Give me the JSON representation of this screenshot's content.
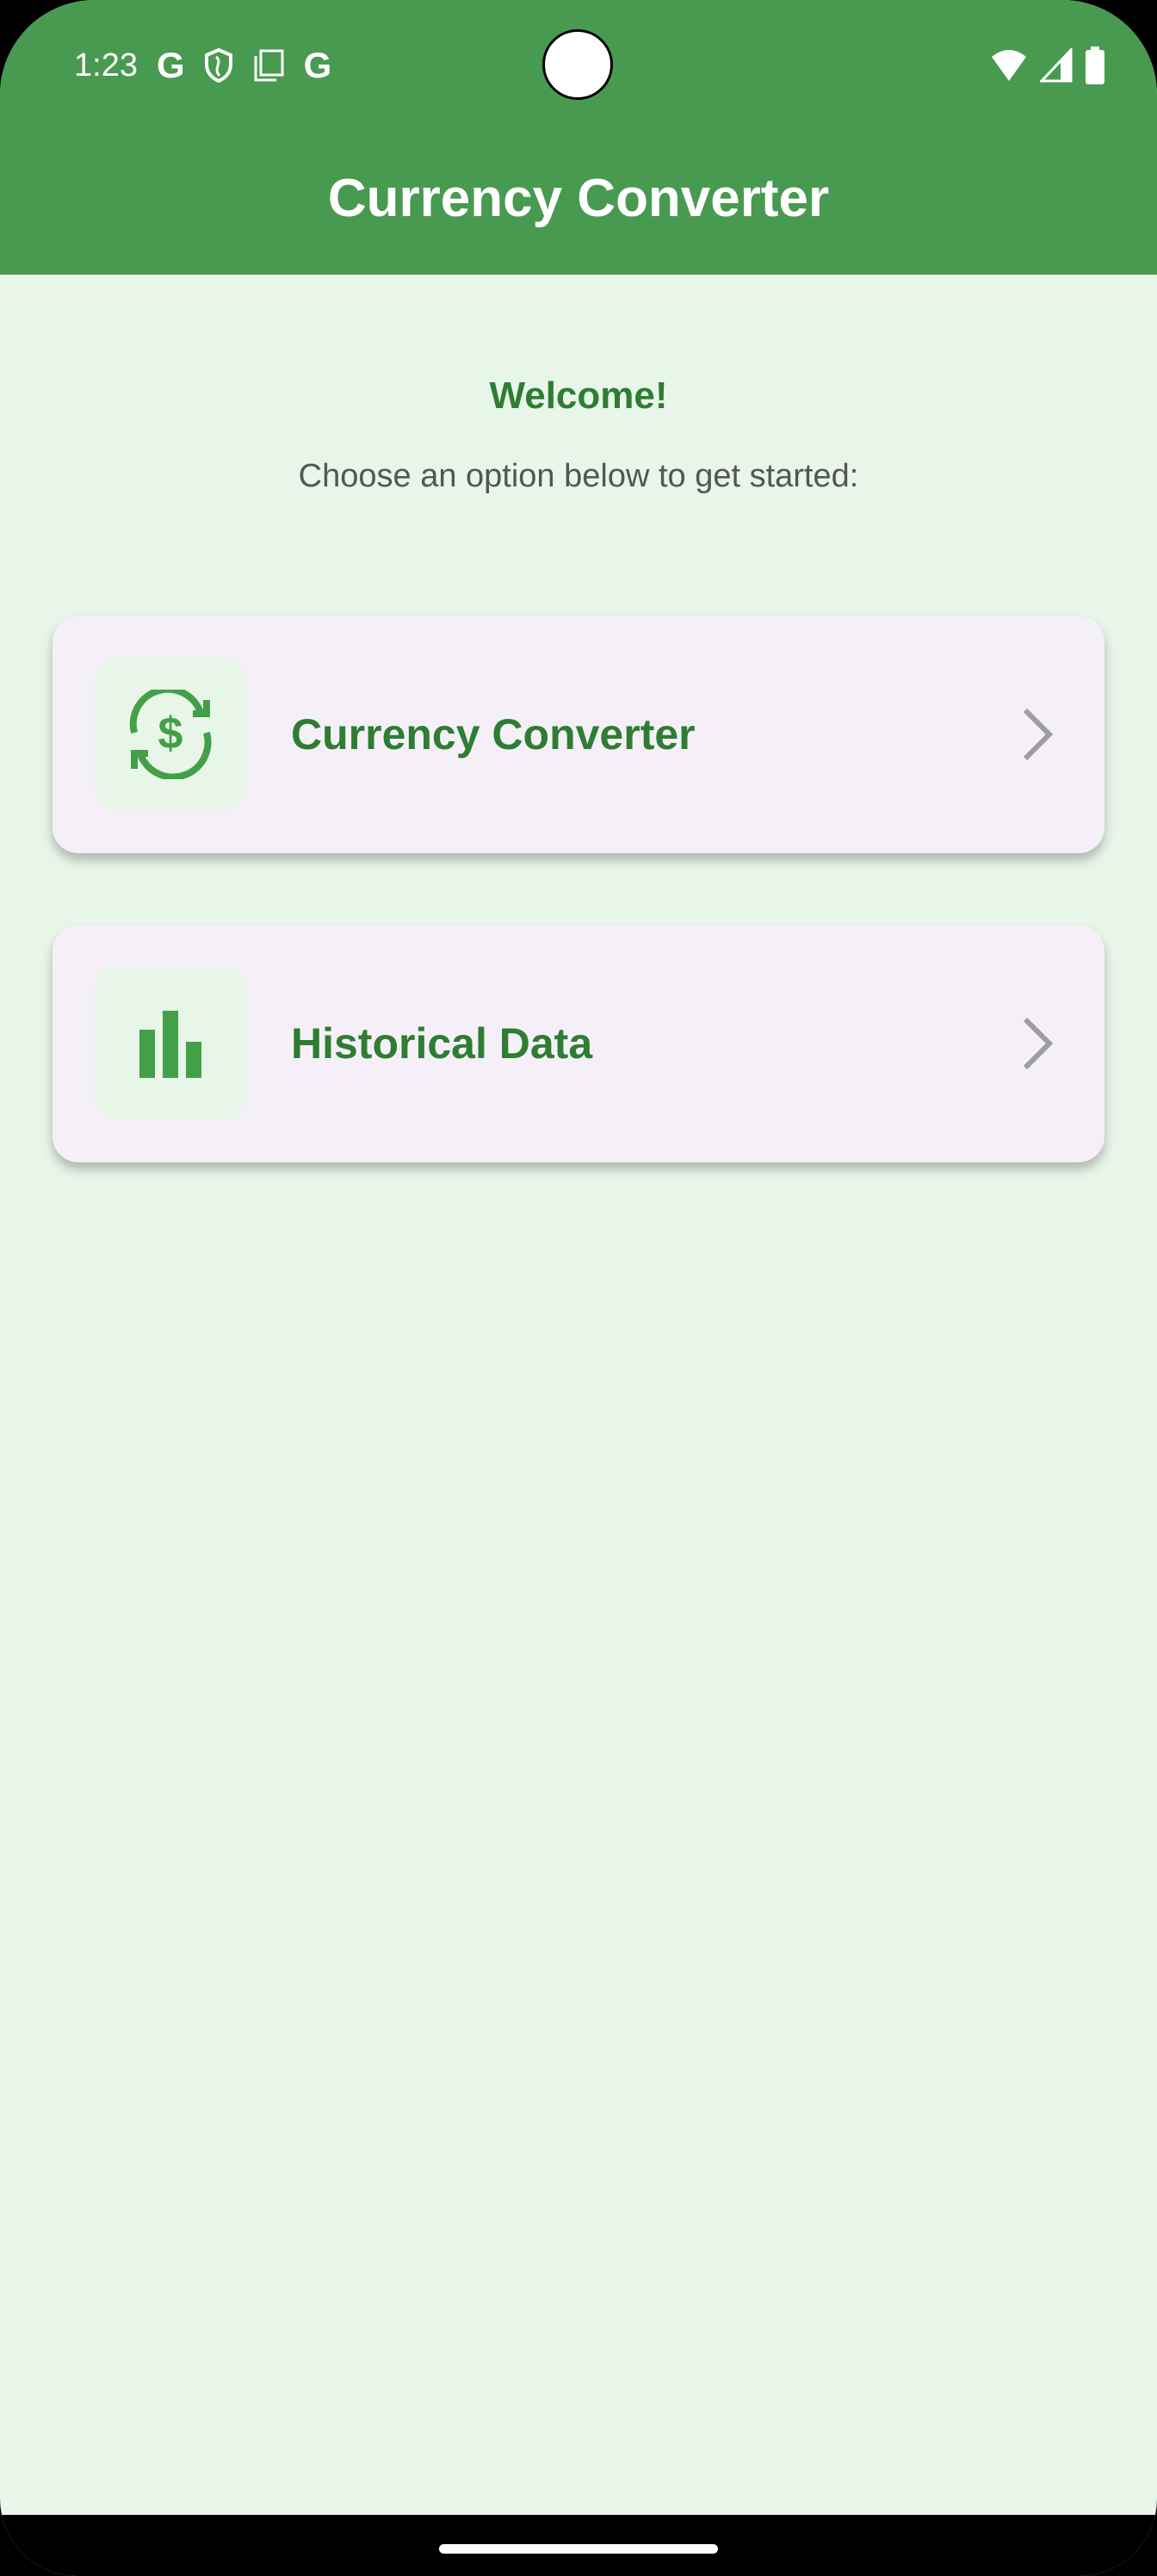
{
  "status_bar": {
    "time": "1:23",
    "icons": [
      "google-icon",
      "shield-icon",
      "copy-icon",
      "google-icon"
    ],
    "right_icons": [
      "wifi-icon",
      "signal-icon",
      "battery-icon"
    ]
  },
  "app_bar": {
    "title": "Currency Converter"
  },
  "main": {
    "welcome": "Welcome!",
    "subtitle": "Choose an option below to get started:",
    "options": [
      {
        "label": "Currency Converter",
        "icon": "currency-exchange-icon"
      },
      {
        "label": "Historical Data",
        "icon": "bar-chart-icon"
      }
    ]
  },
  "colors": {
    "primary": "#489a50",
    "accent_text": "#2e7d32",
    "background": "#e8f5e9",
    "card": "#f5f0f8"
  }
}
